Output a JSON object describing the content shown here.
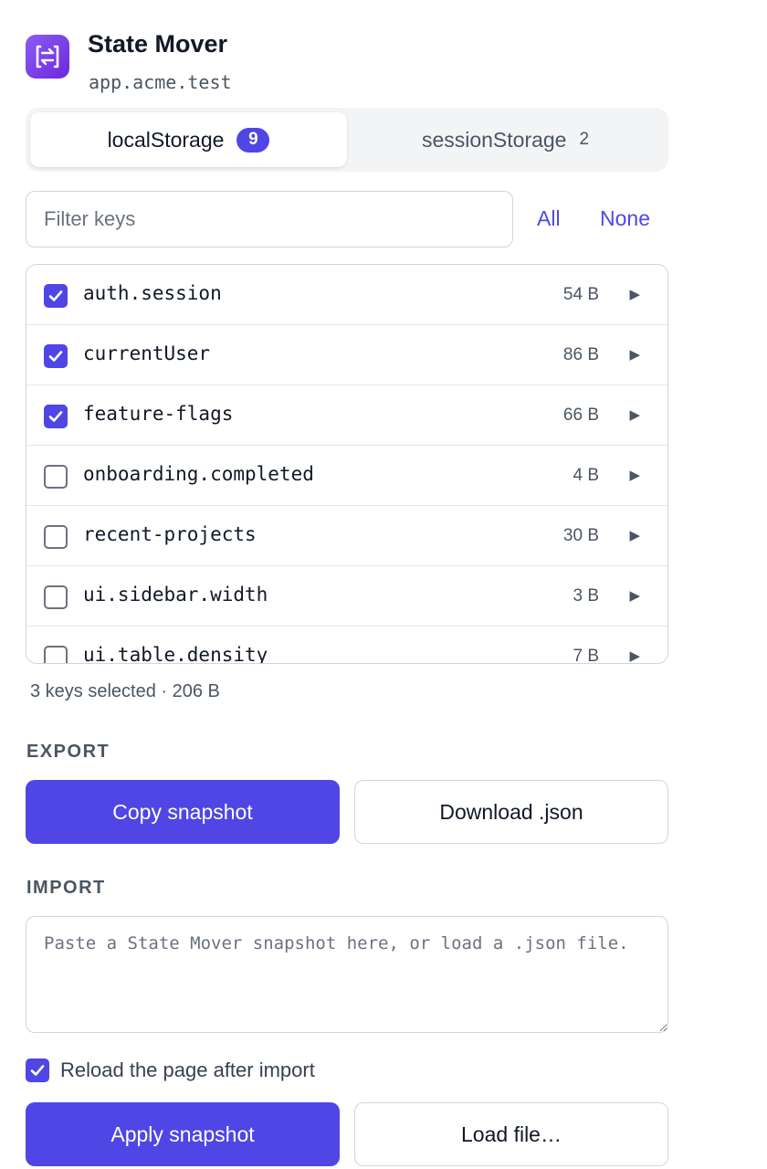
{
  "header": {
    "title": "State Mover",
    "host": "app.acme.test",
    "logo_icon": "swap-arrows-icon",
    "logo_color": "#7c3aed"
  },
  "tabs": [
    {
      "label": "localStorage",
      "count": "9",
      "active": true
    },
    {
      "label": "sessionStorage",
      "count": "2",
      "active": false
    }
  ],
  "filter": {
    "placeholder": "Filter keys",
    "value": "",
    "all_label": "All",
    "none_label": "None"
  },
  "keys": [
    {
      "name": "auth.session",
      "size": "54 B",
      "checked": true
    },
    {
      "name": "currentUser",
      "size": "86 B",
      "checked": true
    },
    {
      "name": "feature-flags",
      "size": "66 B",
      "checked": true
    },
    {
      "name": "onboarding.completed",
      "size": "4 B",
      "checked": false
    },
    {
      "name": "recent-projects",
      "size": "30 B",
      "checked": false
    },
    {
      "name": "ui.sidebar.width",
      "size": "3 B",
      "checked": false
    },
    {
      "name": "ui.table.density",
      "size": "7 B",
      "checked": false
    }
  ],
  "summary": "3 keys selected · 206 B",
  "export": {
    "label": "EXPORT",
    "copy_label": "Copy snapshot",
    "download_label": "Download .json"
  },
  "import": {
    "label": "IMPORT",
    "placeholder": "Paste a State Mover snapshot here, or load a .json file.",
    "reload_label": "Reload the page after import",
    "reload_checked": true,
    "apply_label": "Apply snapshot",
    "load_label": "Load file…"
  },
  "colors": {
    "accent": "#4f46e5",
    "border": "#d1d5db",
    "muted_text": "#4b5563"
  }
}
